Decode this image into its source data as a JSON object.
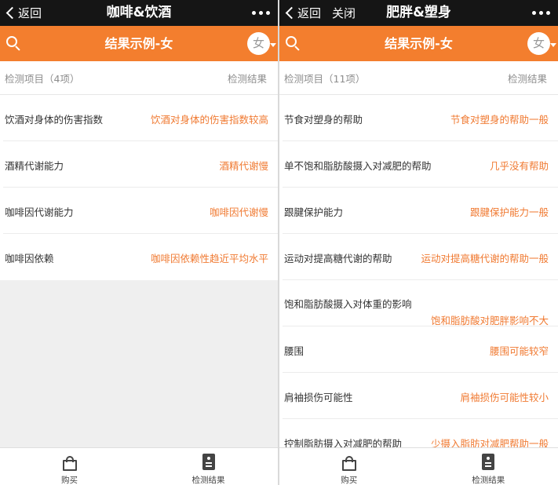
{
  "screens": [
    {
      "nav": {
        "back_label": "返回",
        "close_label": "",
        "page_title": "咖啡&饮酒"
      },
      "result_title": "结果示例-女",
      "gender_badge": "女",
      "header": {
        "items_label": "检测项目（4项）",
        "result_label": "检测结果"
      },
      "rows": [
        {
          "name": "饮酒对身体的伤害指数",
          "value": "饮酒对身体的伤害指数较高"
        },
        {
          "name": "酒精代谢能力",
          "value": "酒精代谢慢"
        },
        {
          "name": "咖啡因代谢能力",
          "value": "咖啡因代谢慢"
        },
        {
          "name": "咖啡因依赖",
          "value": "咖啡因依赖性趋近平均水平"
        }
      ],
      "tabs": {
        "buy": "购买",
        "results": "检测结果"
      }
    },
    {
      "nav": {
        "back_label": "返回",
        "close_label": "关闭",
        "page_title": "肥胖&塑身"
      },
      "result_title": "结果示例-女",
      "gender_badge": "女",
      "header": {
        "items_label": "检测项目（11项）",
        "result_label": "检测结果"
      },
      "rows": [
        {
          "name": "节食对塑身的帮助",
          "value": "节食对塑身的帮助一般"
        },
        {
          "name": "单不饱和脂肪酸摄入对减肥的帮助",
          "value": "几乎没有帮助"
        },
        {
          "name": "跟腱保护能力",
          "value": "跟腱保护能力一般"
        },
        {
          "name": "运动对提高糖代谢的帮助",
          "value": "运动对提高糖代谢的帮助一般"
        },
        {
          "name": "饱和脂肪酸摄入对体重的影响",
          "value": "饱和脂肪酸对肥胖影响不大"
        },
        {
          "name": "腰围",
          "value": "腰围可能较窄"
        },
        {
          "name": "肩袖损伤可能性",
          "value": "肩袖损伤可能性较小"
        },
        {
          "name": "控制脂肪摄入对减肥的帮助",
          "value": "少摄入脂肪对减肥帮助一般"
        }
      ],
      "tabs": {
        "buy": "购买",
        "results": "检测结果"
      }
    }
  ],
  "colors": {
    "accent": "#f37e2e",
    "value_text": "#f07a32",
    "titlebar": "#151515"
  }
}
